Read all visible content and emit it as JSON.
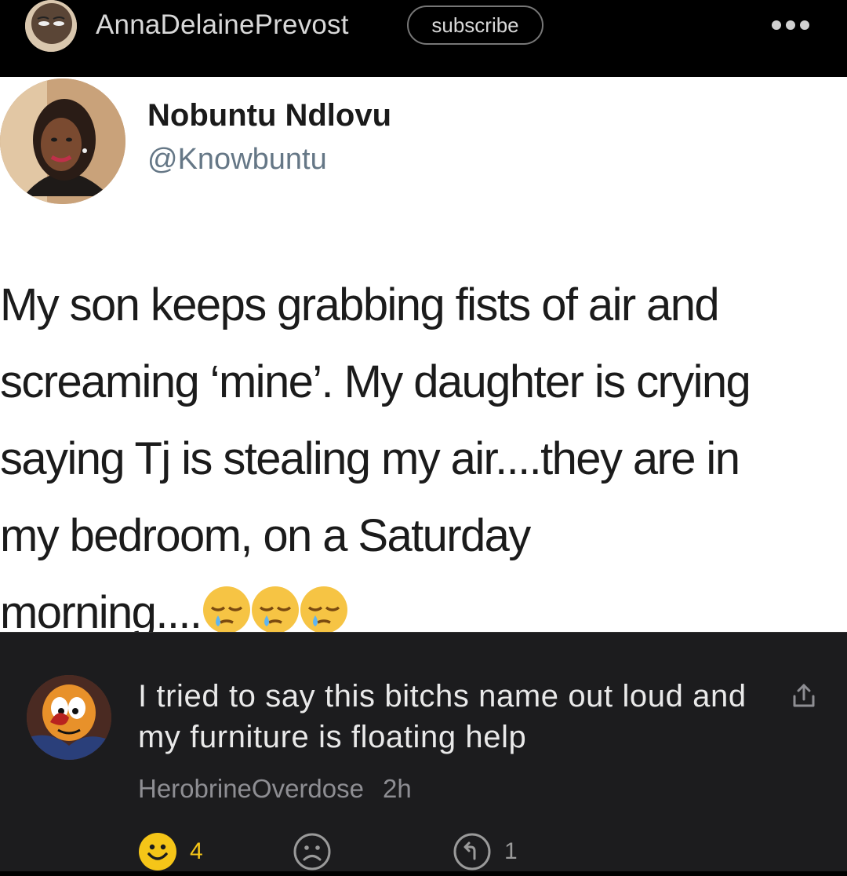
{
  "header": {
    "username": "AnnaDelainePrevost",
    "subscribe_label": "subscribe",
    "avatar_icon": "profile-avatar",
    "more_icon": "more-dots-icon"
  },
  "tweet": {
    "name": "Nobuntu Ndlovu",
    "handle": "@Knowbuntu",
    "text": "My son keeps grabbing fists of air and\nscreaming ‘mine’. My daughter is crying\nsaying Tj is stealing my air....they are in\nmy bedroom, on a Saturday\nmorning....",
    "emoji": [
      "sleepy-face",
      "sleepy-face",
      "sleepy-face"
    ]
  },
  "comment": {
    "text": "I tried to say this bitchs name out loud and my furniture is floating help",
    "author": "HerobrineOverdose",
    "time": "2h",
    "likes": "4",
    "replies": "1",
    "accent": "#f5c518"
  }
}
